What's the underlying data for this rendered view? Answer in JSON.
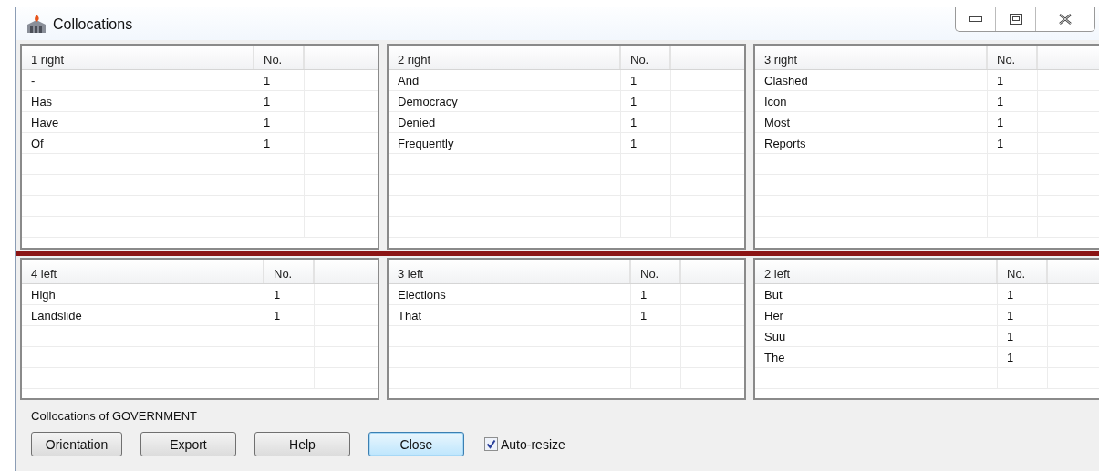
{
  "window": {
    "title": "Collocations"
  },
  "panes_top": [
    {
      "heading": "1 right",
      "count_heading": "No.",
      "rows": [
        {
          "word": "-",
          "count": "1"
        },
        {
          "word": "Has",
          "count": "1"
        },
        {
          "word": "Have",
          "count": "1"
        },
        {
          "word": "Of",
          "count": "1"
        }
      ]
    },
    {
      "heading": "2 right",
      "count_heading": "No.",
      "rows": [
        {
          "word": "And",
          "count": "1"
        },
        {
          "word": "Democracy",
          "count": "1"
        },
        {
          "word": "Denied",
          "count": "1"
        },
        {
          "word": "Frequently",
          "count": "1"
        }
      ]
    },
    {
      "heading": "3 right",
      "count_heading": "No.",
      "rows": [
        {
          "word": "Clashed",
          "count": "1"
        },
        {
          "word": "Icon",
          "count": "1"
        },
        {
          "word": "Most",
          "count": "1"
        },
        {
          "word": "Reports",
          "count": "1"
        }
      ]
    }
  ],
  "panes_bottom": [
    {
      "heading": "4 left",
      "count_heading": "No.",
      "rows": [
        {
          "word": "High",
          "count": "1"
        },
        {
          "word": "Landslide",
          "count": "1"
        }
      ]
    },
    {
      "heading": "3 left",
      "count_heading": "No.",
      "rows": [
        {
          "word": "Elections",
          "count": "1"
        },
        {
          "word": "That",
          "count": "1"
        }
      ]
    },
    {
      "heading": "2 left",
      "count_heading": "No.",
      "rows": [
        {
          "word": "But",
          "count": "1"
        },
        {
          "word": "Her",
          "count": "1"
        },
        {
          "word": "Suu",
          "count": "1"
        },
        {
          "word": "The",
          "count": "1"
        }
      ]
    }
  ],
  "caption": "Collocations of GOVERNMENT",
  "buttons": [
    {
      "label": "Orientation",
      "focused": false
    },
    {
      "label": "Export",
      "focused": false
    },
    {
      "label": "Help",
      "focused": false
    },
    {
      "label": "Close",
      "focused": true
    }
  ],
  "auto_resize": {
    "label": "Auto-resize",
    "checked": true
  }
}
